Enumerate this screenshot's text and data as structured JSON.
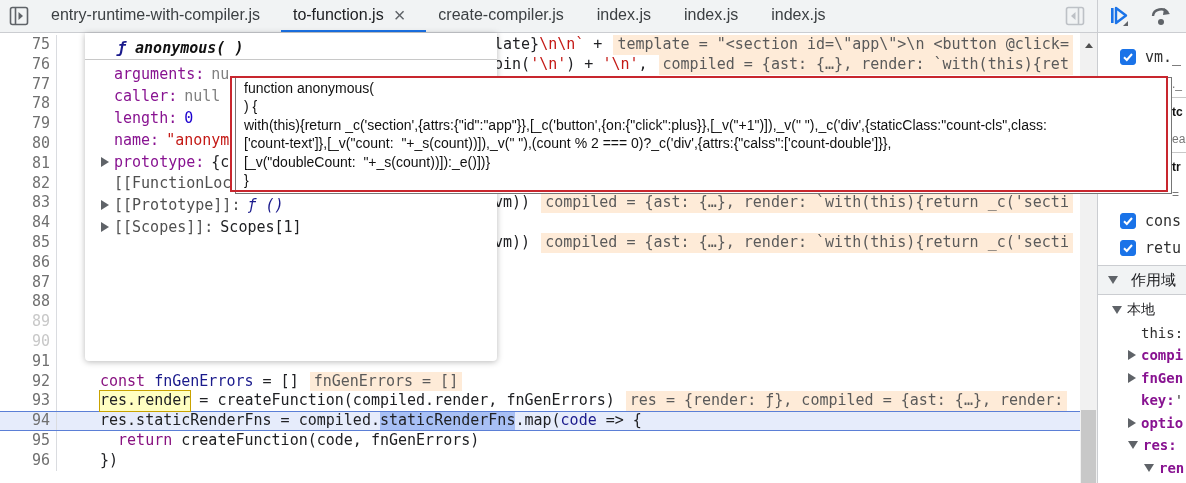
{
  "tabs": [
    {
      "label": "entry-runtime-with-compiler.js",
      "selected": false
    },
    {
      "label": "to-function.js",
      "selected": true,
      "close": "×"
    },
    {
      "label": "create-compiler.js",
      "selected": false
    },
    {
      "label": "index.js",
      "selected": false
    },
    {
      "label": "index.js",
      "selected": false
    },
    {
      "label": "index.js",
      "selected": false
    }
  ],
  "editor": {
    "lines": [
      {
        "number": "75",
        "dim": false,
        "partial": true,
        "current": false,
        "segments": [
          {
            "text": "late}",
            "kind": "plain"
          },
          {
            "text": "\\n\\n`",
            "kind": "string"
          },
          {
            "text": " +",
            "kind": "plain"
          }
        ],
        "value": "template = \"<section id=\\\"app\\\">\\n <button @click="
      },
      {
        "number": "76",
        "dim": false,
        "partial": true,
        "current": false,
        "segments": [
          {
            "text": "oin(",
            "kind": "plain"
          },
          {
            "text": "'\\n'",
            "kind": "string"
          },
          {
            "text": ") + ",
            "kind": "plain"
          },
          {
            "text": "'\\n'",
            "kind": "string"
          },
          {
            "text": ",",
            "kind": "plain"
          }
        ],
        "value": "compiled = {ast: {…}, render: `with(this){ret"
      },
      {
        "number": "77",
        "dim": false,
        "partial": false,
        "current": false
      },
      {
        "number": "78",
        "dim": false,
        "partial": false,
        "current": false
      },
      {
        "number": "79",
        "dim": false,
        "partial": false,
        "current": false
      },
      {
        "number": "80",
        "dim": false,
        "partial": false,
        "current": false
      },
      {
        "number": "81",
        "dim": false,
        "partial": false,
        "current": false
      },
      {
        "number": "82",
        "dim": false,
        "partial": false,
        "current": false
      },
      {
        "number": "83",
        "dim": false,
        "partial": true,
        "current": false,
        "segments": [
          {
            "text": "vm))",
            "kind": "plain"
          }
        ],
        "value": "compiled = {ast: {…}, render: `with(this){return _c('secti"
      },
      {
        "number": "84",
        "dim": false,
        "partial": false,
        "current": false
      },
      {
        "number": "85",
        "dim": false,
        "partial": true,
        "current": false,
        "segments": [
          {
            "text": "vm))",
            "kind": "plain"
          }
        ],
        "value": "compiled = {ast: {…}, render: `with(this){return _c('secti"
      },
      {
        "number": "86",
        "dim": false,
        "partial": false,
        "current": false
      },
      {
        "number": "87",
        "dim": false,
        "partial": false,
        "current": false
      },
      {
        "number": "88",
        "dim": false,
        "partial": false,
        "current": false
      },
      {
        "number": "89",
        "dim": true,
        "partial": false,
        "current": false
      },
      {
        "number": "90",
        "dim": true,
        "partial": false,
        "current": false
      },
      {
        "number": "91",
        "dim": false,
        "partial": false,
        "current": false
      },
      {
        "number": "92",
        "dim": false,
        "partial": false,
        "current": false,
        "segments": [
          {
            "text": "const",
            "kind": "keyword"
          },
          {
            "text": " fnGenErrors",
            "kind": "variable"
          },
          {
            "text": " = []",
            "kind": "plain"
          }
        ],
        "value": "fnGenErrors = []"
      },
      {
        "number": "93",
        "dim": false,
        "partial": false,
        "current": false,
        "segments": [
          {
            "text": "res.render",
            "kind": "mark"
          },
          {
            "text": " = createFunction(compiled.render, fnGenErrors)",
            "kind": "plain"
          }
        ],
        "value": "res = {render: ƒ}, compiled = {ast: {…}, render:"
      },
      {
        "number": "94",
        "dim": false,
        "partial": false,
        "current": true,
        "segments": [
          {
            "text": "res.staticRenderFns = compiled.",
            "kind": "plain"
          },
          {
            "text": "staticRenderFns",
            "kind": "select"
          },
          {
            "text": ".map(",
            "kind": "plain"
          },
          {
            "text": "code",
            "kind": "variable"
          },
          {
            "text": " => {",
            "kind": "plain"
          }
        ]
      },
      {
        "number": "95",
        "dim": false,
        "partial": false,
        "current": false,
        "segments": [
          {
            "text": "  return",
            "kind": "keyword"
          },
          {
            "text": " createFunction(code, fnGenErrors)",
            "kind": "plain"
          }
        ]
      },
      {
        "number": "96",
        "dim": false,
        "partial": false,
        "current": false,
        "segments": [
          {
            "text": "})",
            "kind": "plain"
          }
        ]
      }
    ]
  },
  "popover": {
    "sign": "ƒ",
    "title": "anonymous( )",
    "properties": [
      {
        "key": "arguments:",
        "value": "nu",
        "kind": "null",
        "expandable": false
      },
      {
        "key": "caller:",
        "value": "null",
        "kind": "null",
        "expandable": false
      },
      {
        "key": "length:",
        "value": "0",
        "kind": "number",
        "expandable": false
      },
      {
        "key": "name:",
        "value": "\"anonym",
        "kind": "string",
        "expandable": false
      },
      {
        "key": "prototype:",
        "value": "{c",
        "kind": "object",
        "expandable": true
      },
      {
        "key": "[[FunctionLoc",
        "kind": "internal",
        "expandable": false
      },
      {
        "key": "[[Prototype]]:",
        "value": "ƒ ()",
        "kind": "internal-function",
        "expandable": true
      },
      {
        "key": "[[Scopes]]:",
        "value": "Scopes[1]",
        "kind": "internal-object",
        "expandable": true
      }
    ]
  },
  "tooltip": {
    "lines": [
      "function anonymous(",
      ") {",
      "with(this){return _c('section',{attrs:{\"id\":\"app\"}},[_c('button',{on:{\"click\":plus}},[_v(\"+1\")]),_v(\" \"),_c('div',{staticClass:\"count-cls\",class:",
      "['count-text']},[_v(\"count:  \"+_s(count))]),_v(\" \"),(count % 2 === 0)?_c('div',{attrs:{\"calss\":['count-double']}},",
      "[_v(\"doubleCount:  \"+_s(count))]):_e()])}",
      "}"
    ]
  },
  "right_panel": {
    "rows": [
      {
        "kind": "checkbox",
        "checked": true,
        "text": "vm._"
      },
      {
        "kind": "fragment",
        "text": "._"
      },
      {
        "kind": "fragment-heading",
        "text": "tc"
      },
      {
        "kind": "fragment",
        "text": "ea"
      },
      {
        "kind": "fragment-heading",
        "text": "tr"
      },
      {
        "kind": "fragment",
        "text": "="
      },
      {
        "kind": "checkbox",
        "checked": true,
        "text": "cons"
      },
      {
        "kind": "checkbox",
        "checked": true,
        "text": "retu"
      }
    ],
    "scope": {
      "title": "作用域",
      "expanded": true,
      "tree": [
        {
          "name": "本地",
          "kind": "group",
          "expanded": true,
          "children": [
            {
              "name": "this:",
              "kind": "plain"
            },
            {
              "name": "compi",
              "kind": "own",
              "expanded": false
            },
            {
              "name": "fnGen",
              "kind": "own",
              "expanded": false
            },
            {
              "name": "key:",
              "value": " '",
              "kind": "own"
            },
            {
              "name": "optio",
              "kind": "own",
              "expanded": false
            },
            {
              "name": "res:",
              "kind": "own",
              "expanded": true,
              "children": [
                {
                  "name": "ren",
                  "kind": "own",
                  "expanded": true
                }
              ]
            }
          ]
        }
      ]
    }
  }
}
